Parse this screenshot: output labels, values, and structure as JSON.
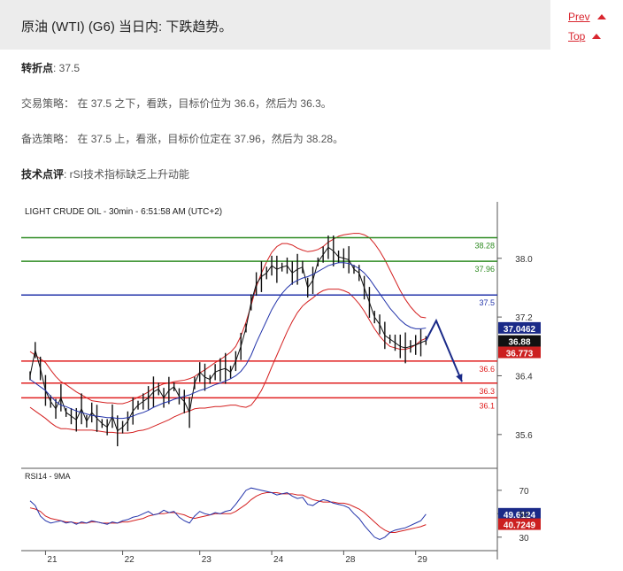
{
  "page": {
    "title": "原油 (WTI) (G6) 当日内: 下跌趋势。",
    "nav": [
      {
        "label": "Prev"
      },
      {
        "label": "Top"
      }
    ]
  },
  "analysis": {
    "pivot_label": "转折点",
    "pivot_value": ": 37.5",
    "strategy_label": "交易策略：",
    "strategy_text": "在 37.5 之下，看跌，目标价位为 36.6，然后为 36.3。",
    "alt_label": "备选策略：",
    "alt_text": "在 37.5 上，看涨，目标价位定在 37.96，然后为 38.28。",
    "comment_label": "技术点评",
    "comment_text": ": rSI技术指标缺乏上升动能"
  },
  "colors": {
    "accent": "#d9262f",
    "resistance": "#2e8b22",
    "pivot": "#2233aa",
    "support": "#e02020",
    "price": "#111111",
    "bollinger": "#d42020",
    "ma": "#2233aa",
    "forecast": "#1a2a88",
    "pivot_tag": "#1a2a88",
    "last_tag": "#111111",
    "lower_tag": "#cc2020"
  },
  "chart_data": {
    "type": "line",
    "title": "LIGHT CRUDE OIL - 30min - 6:51:58 AM (UTC+2)",
    "price_axis": {
      "ylim": [
        35.2,
        38.6
      ],
      "ticks": [
        35.6,
        36.4,
        37.2,
        38.0
      ]
    },
    "x_ticks": [
      "21",
      "22",
      "23",
      "24",
      "28",
      "29"
    ],
    "grid": true,
    "levels": [
      {
        "value": 38.28,
        "label": "38.28",
        "kind": "resistance"
      },
      {
        "value": 37.96,
        "label": "37.96",
        "kind": "resistance"
      },
      {
        "value": 37.5,
        "label": "37.5",
        "kind": "pivot"
      },
      {
        "value": 36.6,
        "label": "36.6",
        "kind": "support"
      },
      {
        "value": 36.3,
        "label": "36.3",
        "kind": "support"
      },
      {
        "value": 36.1,
        "label": "36.1",
        "kind": "support"
      }
    ],
    "price_tags": [
      {
        "value": 37.0462,
        "label": "37.0462",
        "kind": "pivot_tag"
      },
      {
        "value": 36.88,
        "label": "36.88",
        "kind": "last_tag"
      },
      {
        "value": 36.773,
        "label": "36.773",
        "kind": "lower_tag"
      }
    ],
    "price": [
      36.4,
      36.75,
      36.5,
      36.2,
      36.05,
      35.95,
      36.1,
      35.9,
      35.85,
      35.8,
      35.95,
      35.78,
      35.9,
      35.82,
      35.75,
      35.7,
      35.85,
      35.65,
      35.7,
      35.78,
      35.92,
      36.0,
      36.05,
      36.1,
      36.18,
      36.22,
      36.1,
      36.2,
      36.25,
      36.12,
      36.05,
      35.9,
      36.3,
      36.45,
      36.38,
      36.35,
      36.45,
      36.48,
      36.5,
      36.45,
      36.6,
      36.8,
      37.05,
      37.4,
      37.65,
      37.75,
      37.8,
      37.9,
      37.85,
      37.88,
      37.9,
      37.8,
      37.85,
      37.88,
      37.6,
      37.7,
      37.95,
      38.05,
      38.15,
      38.1,
      38.02,
      38.0,
      37.98,
      37.85,
      37.8,
      37.6,
      37.4,
      37.2,
      37.1,
      36.95,
      36.9,
      36.85,
      36.8,
      36.78,
      36.8,
      36.82,
      36.85,
      36.88
    ],
    "ma": [
      36.35,
      36.3,
      36.25,
      36.2,
      36.12,
      36.05,
      36.0,
      35.98,
      35.95,
      35.92,
      35.9,
      35.88,
      35.86,
      35.85,
      35.84,
      35.83,
      35.83,
      35.82,
      35.82,
      35.83,
      35.85,
      35.88,
      35.9,
      35.93,
      35.97,
      36.0,
      36.03,
      36.05,
      36.08,
      36.1,
      36.12,
      36.14,
      36.17,
      36.2,
      36.22,
      36.25,
      36.28,
      36.3,
      36.33,
      36.36,
      36.4,
      36.46,
      36.55,
      36.68,
      36.85,
      37.0,
      37.15,
      37.3,
      37.42,
      37.52,
      37.6,
      37.66,
      37.7,
      37.73,
      37.75,
      37.78,
      37.82,
      37.86,
      37.9,
      37.92,
      37.94,
      37.94,
      37.93,
      37.9,
      37.86,
      37.8,
      37.72,
      37.62,
      37.52,
      37.42,
      37.32,
      37.24,
      37.16,
      37.1,
      37.06,
      37.04,
      37.04,
      37.05
    ],
    "boll_width": [
      0.38,
      0.38,
      0.38,
      0.38,
      0.36,
      0.34,
      0.32,
      0.3,
      0.28,
      0.26,
      0.24,
      0.22,
      0.2,
      0.2,
      0.2,
      0.2,
      0.2,
      0.2,
      0.2,
      0.21,
      0.22,
      0.23,
      0.24,
      0.25,
      0.26,
      0.26,
      0.26,
      0.25,
      0.24,
      0.23,
      0.22,
      0.22,
      0.22,
      0.24,
      0.26,
      0.28,
      0.3,
      0.32,
      0.34,
      0.36,
      0.4,
      0.48,
      0.58,
      0.68,
      0.76,
      0.8,
      0.8,
      0.78,
      0.74,
      0.68,
      0.6,
      0.52,
      0.44,
      0.38,
      0.34,
      0.32,
      0.3,
      0.3,
      0.32,
      0.34,
      0.36,
      0.38,
      0.4,
      0.44,
      0.48,
      0.52,
      0.56,
      0.58,
      0.58,
      0.56,
      0.52,
      0.46,
      0.4,
      0.34,
      0.28,
      0.22,
      0.16,
      0.14
    ],
    "forecast": {
      "points": [
        [
          77,
          36.88
        ],
        [
          79,
          37.15
        ],
        [
          84,
          36.32
        ]
      ]
    },
    "rsi": {
      "label": "RSI14 - 9MA",
      "ylim": [
        20,
        85
      ],
      "ticks": [
        30,
        50,
        70
      ],
      "tags": [
        {
          "value": 49.6124,
          "label": "49.6124",
          "kind": "pivot_tag"
        },
        {
          "value": 40.7249,
          "label": "40.7249",
          "kind": "lower_tag"
        }
      ],
      "rsi": [
        61,
        57,
        48,
        44,
        42,
        43,
        44,
        42,
        43,
        41,
        43,
        42,
        44,
        43,
        42,
        41,
        43,
        42,
        44,
        45,
        47,
        48,
        50,
        52,
        49,
        50,
        53,
        51,
        52,
        47,
        44,
        42,
        48,
        52,
        50,
        49,
        51,
        50,
        52,
        53,
        58,
        64,
        70,
        72,
        71,
        70,
        69,
        68,
        66,
        67,
        68,
        65,
        63,
        64,
        58,
        57,
        60,
        62,
        61,
        59,
        58,
        57,
        55,
        50,
        46,
        40,
        35,
        30,
        28,
        30,
        34,
        36,
        37,
        38,
        40,
        42,
        44,
        49.6
      ],
      "ma": [
        55,
        54,
        52,
        48,
        46,
        45,
        44,
        43,
        43,
        42,
        42,
        42,
        43,
        43,
        42,
        42,
        42,
        42,
        43,
        43,
        44,
        45,
        46,
        48,
        49,
        50,
        50,
        51,
        51,
        50,
        49,
        47,
        46,
        47,
        48,
        49,
        50,
        50,
        50,
        50,
        52,
        55,
        58,
        62,
        65,
        67,
        68,
        68,
        68,
        67,
        67,
        67,
        66,
        66,
        64,
        62,
        61,
        60,
        60,
        60,
        59,
        59,
        58,
        56,
        54,
        51,
        47,
        43,
        39,
        36,
        34,
        34,
        35,
        36,
        37,
        38,
        39,
        40.7
      ]
    },
    "label_offsets": {
      "resistance_1": 0,
      "dummy": 0
    }
  }
}
